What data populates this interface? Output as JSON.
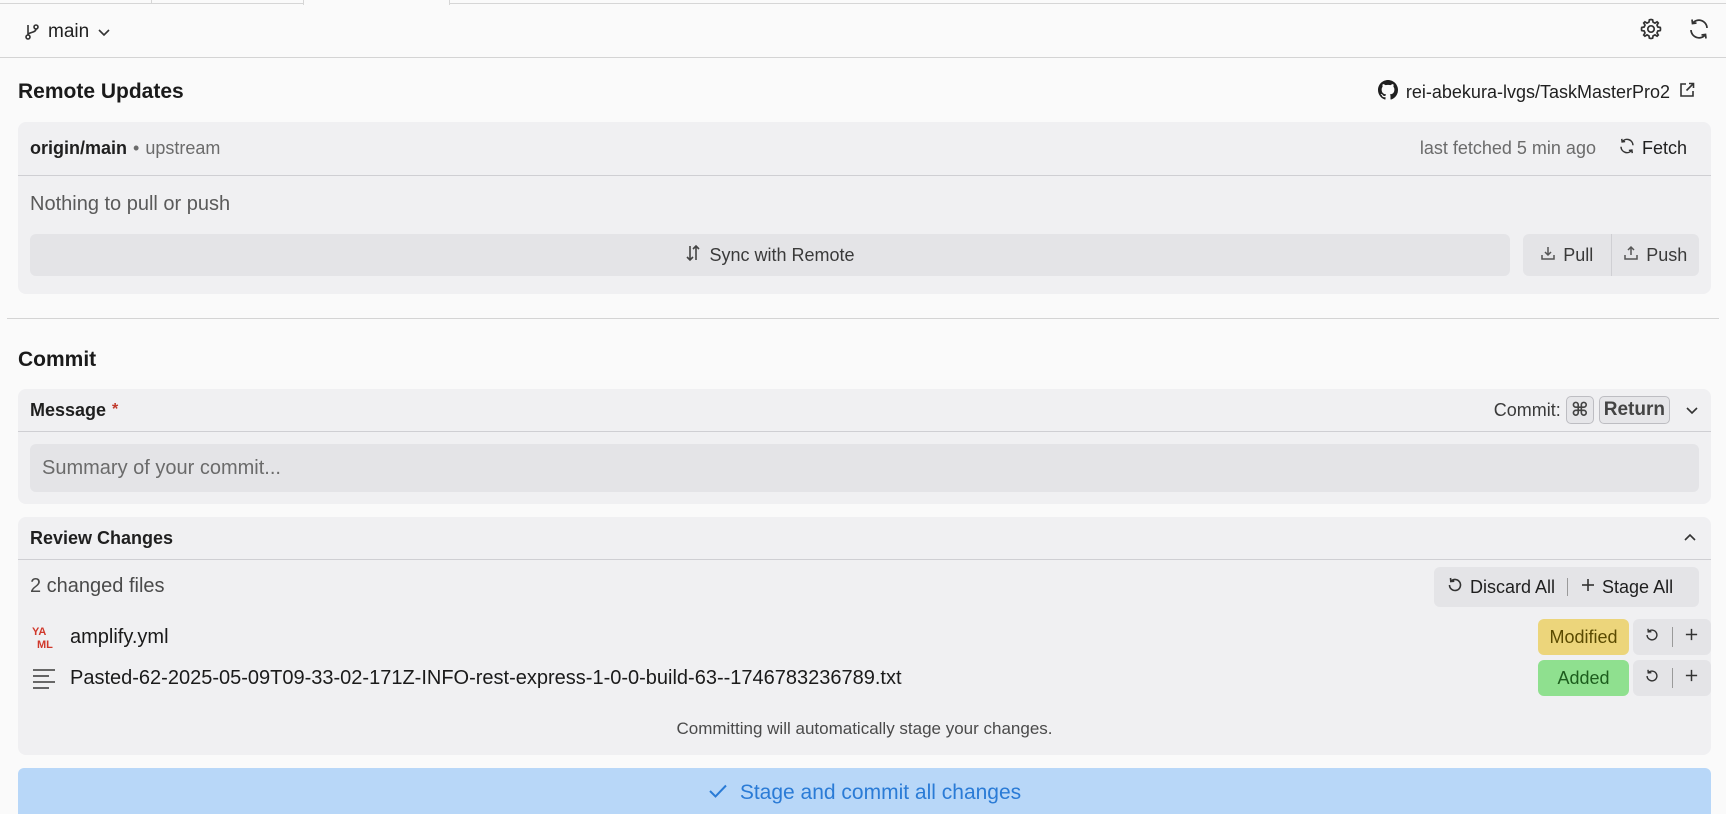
{
  "topbar": {
    "branch_name": "main"
  },
  "remote": {
    "section_title": "Remote Updates",
    "repo_name": "rei-abekura-lvgs/TaskMasterPro2",
    "remote_branch": "origin/main",
    "separator": "•",
    "upstream_label": "upstream",
    "last_fetched": "last fetched 5 min ago",
    "fetch_label": "Fetch",
    "status_text": "Nothing to pull or push",
    "sync_label": "Sync with Remote",
    "pull_label": "Pull",
    "push_label": "Push"
  },
  "commit": {
    "section_title": "Commit",
    "message_label": "Message",
    "required_mark": "*",
    "shortcut_prefix": "Commit:",
    "shortcut_key_cmd": "⌘",
    "shortcut_key_return": "Return",
    "message_placeholder": "Summary of your commit...",
    "message_value": ""
  },
  "review": {
    "title": "Review Changes",
    "changed_count": "2 changed files",
    "discard_all_label": "Discard All",
    "stage_all_label": "Stage All",
    "files": [
      {
        "name": "amplify.yml",
        "icon": "yaml-file-icon",
        "status": "Modified",
        "status_color": "#ecd57b"
      },
      {
        "name": "Pasted-62-2025-05-09T09-33-02-171Z-INFO-rest-express-1-0-0-build-63--1746783236789.txt",
        "icon": "text-file-icon",
        "status": "Added",
        "status_color": "#8fe08f"
      }
    ],
    "yaml_icon_text_top": "YA",
    "yaml_icon_text_bottom": "ML",
    "auto_stage_note": "Committing will automatically stage your changes."
  },
  "footer": {
    "commit_button_label": "Stage and commit all changes",
    "accent_color": "#2a7bd6"
  }
}
